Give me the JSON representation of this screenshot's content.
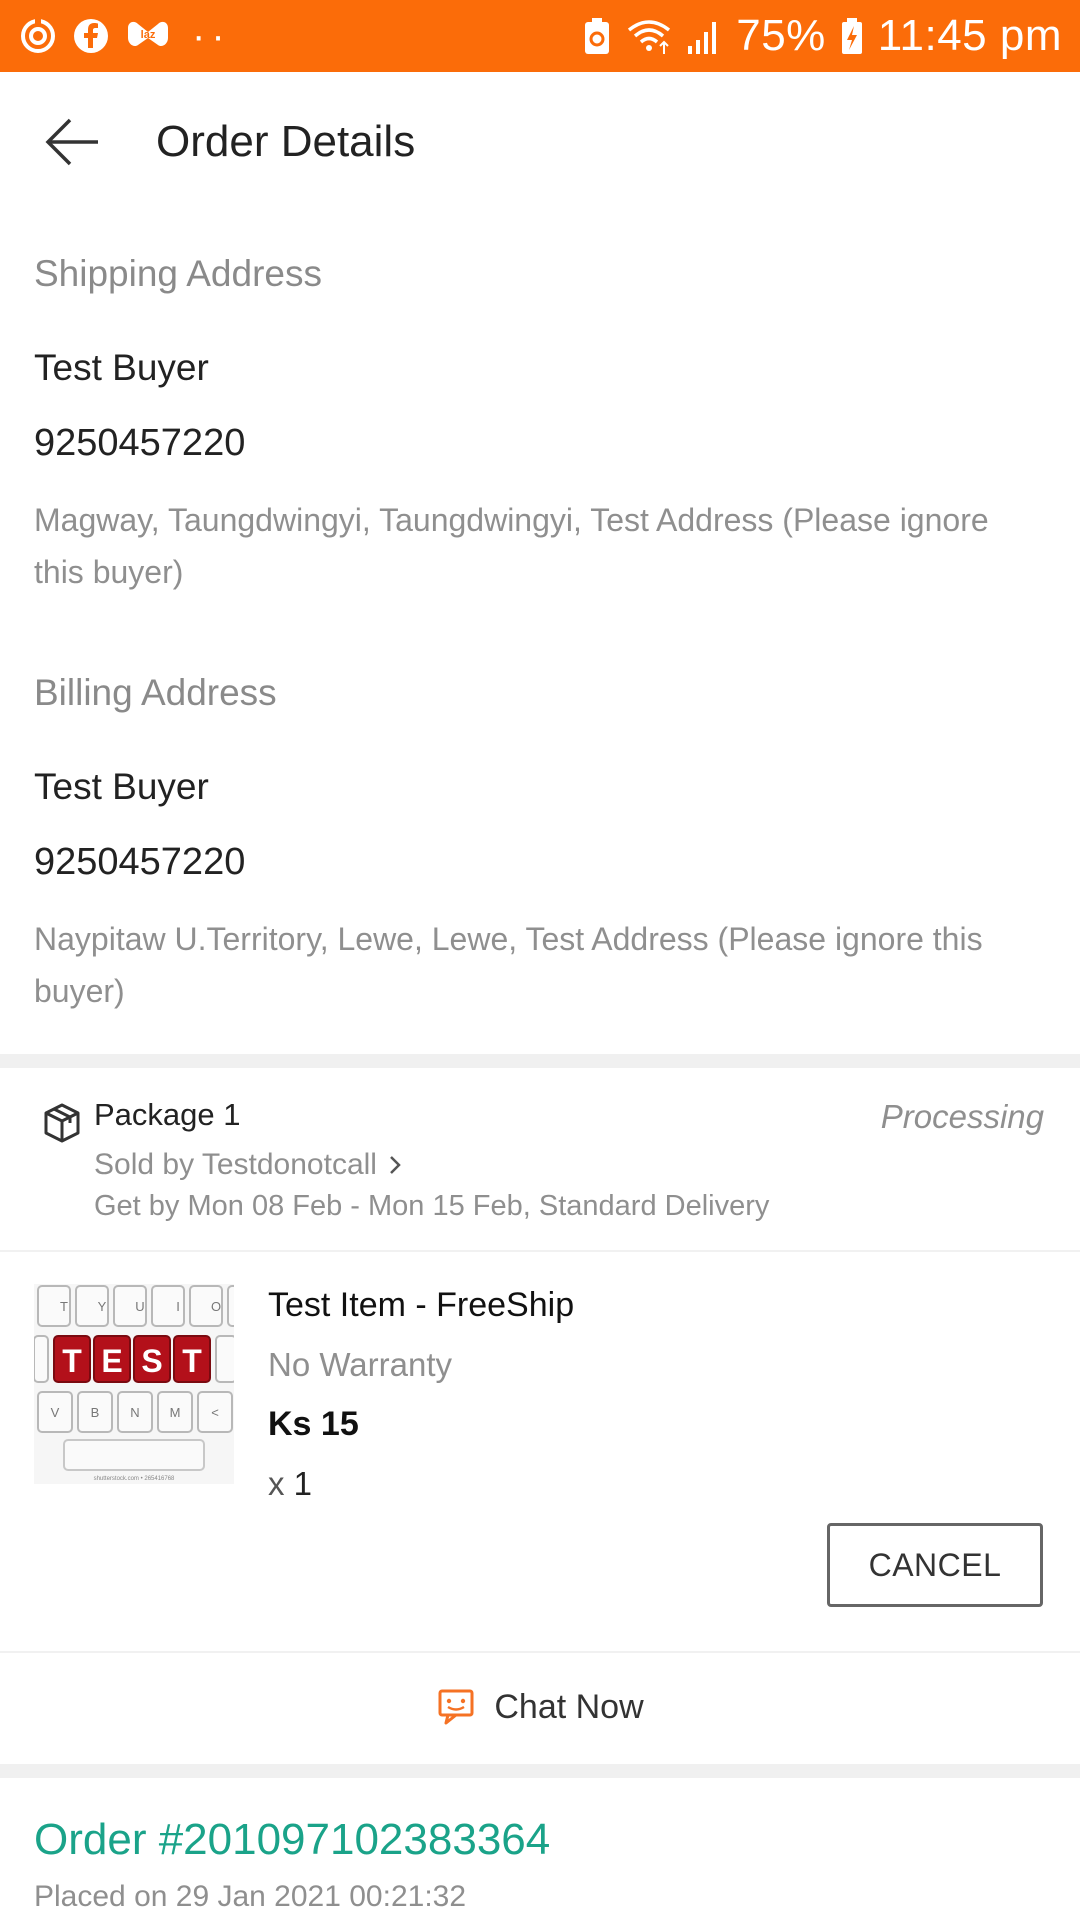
{
  "status_bar": {
    "battery_percent": "75%",
    "time": "11:45 pm",
    "left_icons": [
      "sync-icon",
      "facebook-icon",
      "lazada-icon"
    ],
    "right_icons": [
      "battery-saver-icon",
      "wifi-icon",
      "signal-icon",
      "battery-charging-icon"
    ],
    "bg_color": "#fb6c09"
  },
  "header": {
    "title": "Order Details"
  },
  "shipping": {
    "label": "Shipping Address",
    "name": "Test Buyer",
    "phone": "9250457220",
    "address": "Magway, Taungdwingyi, Taungdwingyi, Test Address (Please ignore this buyer)"
  },
  "billing": {
    "label": "Billing Address",
    "name": "Test Buyer",
    "phone": "9250457220",
    "address": "Naypitaw U.Territory, Lewe, Lewe, Test Address (Please ignore this buyer)"
  },
  "package": {
    "title": "Package 1",
    "status": "Processing",
    "seller": "Sold by Testdonotcall",
    "delivery": "Get by Mon 08 Feb - Mon 15 Feb, Standard Delivery"
  },
  "item": {
    "title": "Test Item - FreeShip",
    "warranty": "No Warranty",
    "price": "Ks 15",
    "qty_prefix": "x",
    "qty": "1",
    "image_caption": "shutterstock.com • 265416768",
    "image_keys": [
      "T",
      "Y",
      "U",
      "I",
      "O",
      "T",
      "E",
      "S",
      "T",
      "V",
      "B",
      "N",
      "M",
      "<"
    ],
    "cancel_label": "CANCEL"
  },
  "chat": {
    "label": "Chat Now",
    "icon_color": "#f57224"
  },
  "order": {
    "number": "Order #201097102383364",
    "placed": "Placed on 29 Jan 2021  00:21:32",
    "number_color": "#1aa389"
  }
}
